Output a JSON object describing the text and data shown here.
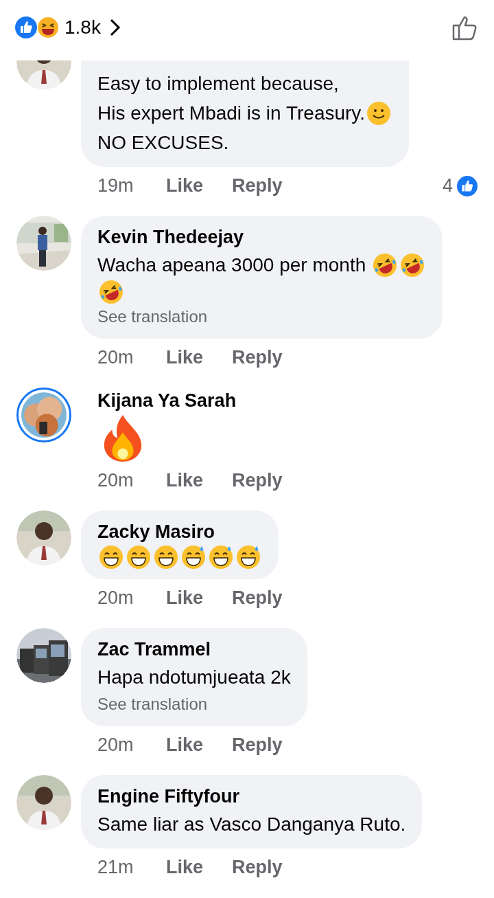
{
  "header": {
    "reaction_count": "1.8k"
  },
  "comments": [
    {
      "story_ring": false,
      "bubble": true,
      "lines": [
        [
          {
            "kind": "text",
            "text": "Easy to implement because,"
          }
        ],
        [
          {
            "kind": "text",
            "text": "His expert Mbadi is in Treasury."
          },
          {
            "kind": "smile"
          }
        ],
        [
          {
            "kind": "text",
            "text": "NO EXCUSES."
          }
        ]
      ],
      "time": "19m",
      "like": "Like",
      "reply": "Reply",
      "likes": "4"
    },
    {
      "author": "Kevin Thedeejay",
      "story_ring": false,
      "bubble": true,
      "lines": [
        [
          {
            "kind": "text",
            "text": "Wacha apeana 3000 per month "
          },
          {
            "kind": "rofl"
          },
          {
            "kind": "rofl"
          }
        ],
        [
          {
            "kind": "rofl"
          }
        ]
      ],
      "see_translation": "See translation",
      "time": "20m",
      "like": "Like",
      "reply": "Reply"
    },
    {
      "author": "Kijana Ya Sarah",
      "story_ring": true,
      "bubble": false,
      "lines": [
        [
          {
            "kind": "fire"
          }
        ]
      ],
      "time": "20m",
      "like": "Like",
      "reply": "Reply"
    },
    {
      "author": "Zacky Masiro",
      "story_ring": false,
      "bubble": true,
      "lines": [
        [
          {
            "kind": "grin"
          },
          {
            "kind": "grin"
          },
          {
            "kind": "grin"
          },
          {
            "kind": "sweat"
          },
          {
            "kind": "sweat"
          },
          {
            "kind": "sweat"
          }
        ]
      ],
      "time": "20m",
      "like": "Like",
      "reply": "Reply"
    },
    {
      "author": "Zac Trammel",
      "story_ring": false,
      "bubble": true,
      "lines": [
        [
          {
            "kind": "text",
            "text": "Hapa ndotumjueata 2k"
          }
        ]
      ],
      "see_translation": "See translation",
      "time": "20m",
      "like": "Like",
      "reply": "Reply"
    },
    {
      "author": "Engine Fiftyfour",
      "story_ring": false,
      "bubble": true,
      "lines": [
        [
          {
            "kind": "text",
            "text": "Same liar as Vasco Danganya Ruto."
          }
        ]
      ],
      "time": "21m",
      "like": "Like",
      "reply": "Reply"
    }
  ]
}
